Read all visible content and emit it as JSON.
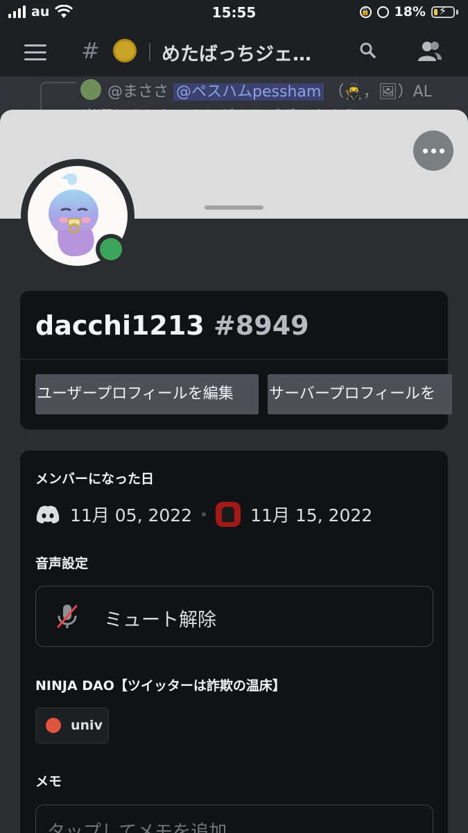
{
  "status_bar": {
    "carrier": "au",
    "time": "15:55",
    "battery": "18%",
    "battery_level": 0.18
  },
  "channel_header": {
    "hash": "#",
    "channel_name": "めたばっちジェ…"
  },
  "chat_preview": {
    "line1_name": "@まささ",
    "line1_mention": "@ペスハムpessham",
    "line1_rest": "（🥷，🖼）AL",
    "line2": "当選しました！ありがとうございます😊！"
  },
  "profile": {
    "username": "dacchi1213",
    "discriminator": "#8949",
    "status": "online",
    "status_color": "#3ba55c",
    "buttons": {
      "edit_user_profile": "ユーザープロフィールを編集",
      "edit_server_profile": "サーバープロフィールを"
    }
  },
  "member_since": {
    "title": "メンバーになった日",
    "discord_date": "11月 05, 2022",
    "separator": "•",
    "server_date": "11月 15, 2022"
  },
  "voice_settings": {
    "title": "音声設定",
    "unmute_label": "ミュート解除"
  },
  "server_roles": {
    "title": "NINJA DAO【ツイッターは詐欺の温床】",
    "roles": [
      {
        "name": "univ",
        "color": "#e0533d"
      }
    ]
  },
  "memo": {
    "title": "メモ",
    "placeholder": "タップしてメモを追加"
  }
}
